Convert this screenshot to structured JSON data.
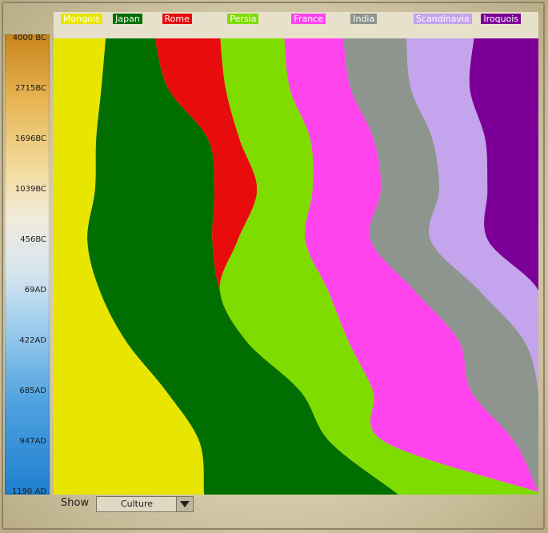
{
  "chart_data": {
    "type": "area",
    "stacking": "proportional",
    "y_axis_ticks": [
      "4000 BC",
      "2715BC",
      "1696BC",
      "1039BC",
      "456BC",
      "69AD",
      "422AD",
      "685AD",
      "947AD",
      "1190 AD"
    ],
    "series": [
      {
        "name": "Mongols",
        "color": "#e8e600",
        "label_color": "#e8e600",
        "text_color": "#ffffff",
        "values": [
          10.5,
          9.8,
          9.2,
          9.1,
          7.8,
          9.5,
          14.7,
          22.5,
          29.3,
          31.0
        ]
      },
      {
        "name": "Japan",
        "color": "#006e00",
        "label_color": "#006e00",
        "text_color": "#ffffff",
        "values": [
          9.9,
          13.8,
          24.2,
          26.2,
          28.9,
          24.8,
          24.5,
          26.8,
          26.2,
          39.5
        ]
      },
      {
        "name": "Rome",
        "color": "#e80c0c",
        "label_color": "#e80c0c",
        "text_color": "#ffffff",
        "values": [
          13.2,
          11.8,
          6.8,
          9.4,
          5.9,
          0.0,
          0.0,
          0.0,
          0.0,
          0.0
        ]
      },
      {
        "name": "Persia",
        "color": "#7edc00",
        "label_color": "#7edc00",
        "text_color": "#ffffff",
        "values": [
          12.9,
          13.2,
          15.3,
          12.2,
          15.6,
          22.3,
          20.8,
          14.5,
          11.0,
          29.5
        ]
      },
      {
        "name": "France",
        "color": "#ff44ee",
        "label_color": "#ff44ee",
        "text_color": "#ffffff",
        "values": [
          11.9,
          12.5,
          13.7,
          15.0,
          15.1,
          17.8,
          22.5,
          19.6,
          26.1,
          0.0
        ]
      },
      {
        "name": "India",
        "color": "#8e948e",
        "label_color": "#8e948e",
        "text_color": "#ffffff",
        "values": [
          12.7,
          12.4,
          12.7,
          12.8,
          13.9,
          13.4,
          13.3,
          13.4,
          4.8,
          0.0
        ]
      },
      {
        "name": "Scandinavia",
        "color": "#c4a4ec",
        "label_color": "#c4a4ec",
        "text_color": "#ffffff",
        "values": [
          13.6,
          12.1,
          11.4,
          10.6,
          13.2,
          12.2,
          2.9,
          0.0,
          0.0,
          0.0
        ]
      },
      {
        "name": "Iroquois",
        "color": "#7c0097",
        "label_color": "#7c0097",
        "text_color": "#ffffff",
        "values": [
          13.0,
          14.1,
          11.5,
          11.2,
          11.7,
          0.0,
          0.0,
          0.0,
          0.0,
          0.0
        ]
      }
    ]
  },
  "footer": {
    "show_label": "Show",
    "dropdown_value": "Culture"
  }
}
